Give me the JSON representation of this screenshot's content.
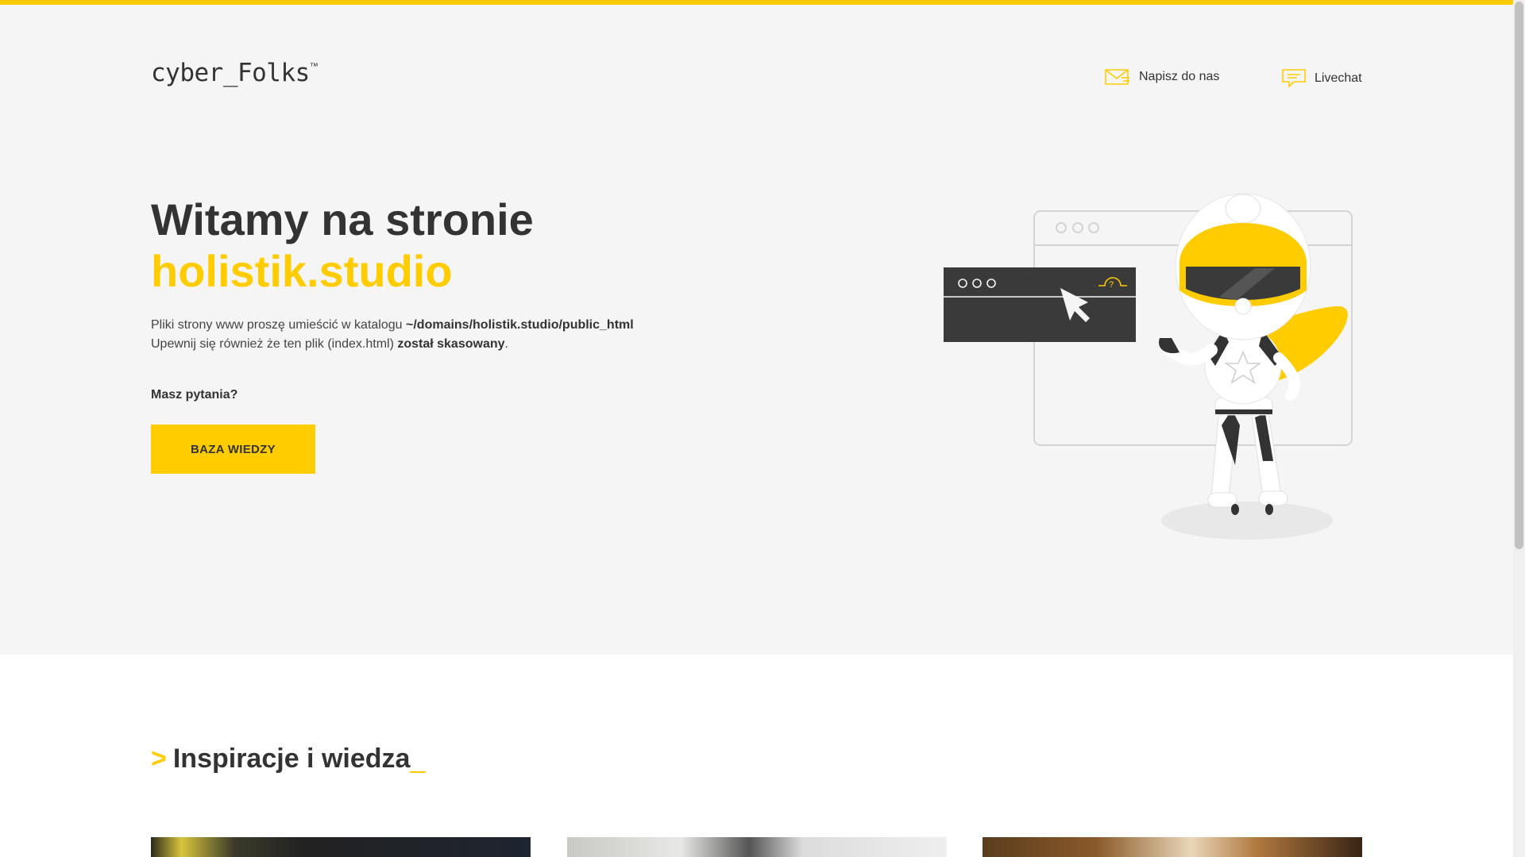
{
  "brand": {
    "logo_text": "cyber_Folks",
    "logo_tm": "™"
  },
  "header": {
    "contact_label": "Napisz do nas",
    "chat_label": "Livechat"
  },
  "hero": {
    "title_line1": "Witamy na stronie",
    "title_domain": "holistik.studio",
    "desc_line1_prefix": "Pliki strony www proszę umieścić w katalogu ",
    "desc_line1_path": "~/domains/holistik.studio/public_html",
    "desc_line2_prefix": "Upewnij się również że ten plik (index.html) ",
    "desc_line2_bold": "został skasowany",
    "desc_line2_suffix": ".",
    "question": "Masz pytania?",
    "button_label": "BAZA WIEDZY"
  },
  "inspiration": {
    "prefix": ">",
    "title": "Inspiracje i wiedza",
    "suffix": "_"
  },
  "colors": {
    "accent": "#ffcc00",
    "text": "#333333",
    "background": "#f5f5f5"
  },
  "icons": [
    "mail-icon",
    "chat-icon"
  ]
}
